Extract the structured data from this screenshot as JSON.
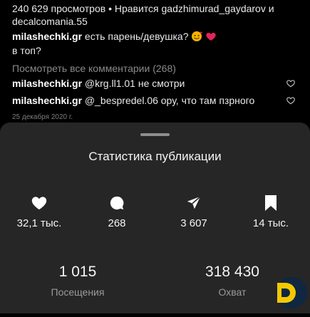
{
  "feed": {
    "views_likes_line1": "240 629 просмотров • Нравится gadzhimurad_gaydarov и",
    "views_likes_line2": "decalcomania.55",
    "caption_user": "milashechki.gr",
    "caption_text": " есть парень/девушка?",
    "caption_text_line2": "в топ?",
    "view_all_comments": "Посмотреть все комментарии (268)",
    "comments": [
      {
        "user": "milashechki.gr",
        "text": " @krg.ll1.01 не смотри"
      },
      {
        "user": "milashechki.gr",
        "text": " @_bespredel.06 ору, что там пзрного"
      }
    ],
    "date": "25 декабря 2020 г."
  },
  "sheet": {
    "title": "Статистика публикации",
    "stats": [
      {
        "icon": "heart-icon",
        "value": "32,1 тыс."
      },
      {
        "icon": "comment-icon",
        "value": "268"
      },
      {
        "icon": "share-icon",
        "value": "3 607"
      },
      {
        "icon": "bookmark-icon",
        "value": "14 тыс."
      }
    ],
    "visits_value": "1 015",
    "visits_label": "Посещения",
    "reach_value": "318 430",
    "reach_label": "Охват"
  },
  "colors": {
    "background": "#000000",
    "sheet": "#262626",
    "emoji_heart": "#e0245e",
    "logo_yellow": "#f5c800",
    "logo_blue": "#0f2740"
  }
}
